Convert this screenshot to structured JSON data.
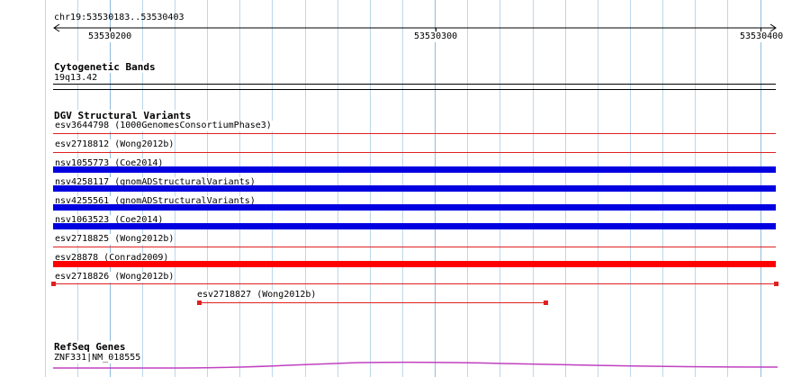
{
  "ruler": {
    "coordinates": "chr19:53530183..53530403",
    "tick_labels": [
      "53530200",
      "53530300",
      "53530400"
    ]
  },
  "tracks": {
    "cytoband": {
      "title": "Cytogenetic Bands",
      "band_label": "19q13.42"
    },
    "dgv": {
      "title": "DGV Structural Variants",
      "features": [
        {
          "label": "esv3644798 (1000GenomesConsortiumPhase3)",
          "color": "#e02020",
          "style": "thin"
        },
        {
          "label": "esv2718812 (Wong2012b)",
          "color": "#e02020",
          "style": "thin"
        },
        {
          "label": "nsv1055773 (Coe2014)",
          "color": "#0000e0",
          "style": "thick"
        },
        {
          "label": "nsv4258117 (gnomADStructuralVariants)",
          "color": "#0000e0",
          "style": "thick"
        },
        {
          "label": "nsv4255561 (gnomADStructuralVariants)",
          "color": "#0000e0",
          "style": "thick"
        },
        {
          "label": "nsv1063523 (Coe2014)",
          "color": "#0000e0",
          "style": "thick"
        },
        {
          "label": "esv2718825 (Wong2012b)",
          "color": "#e02020",
          "style": "thin"
        },
        {
          "label": "esv28878 (Conrad2009)",
          "color": "#ff0000",
          "style": "thick"
        },
        {
          "label": "esv2718826 (Wong2012b)",
          "color": "#e02020",
          "style": "capped"
        },
        {
          "label": "esv2718827 (Wong2012b)",
          "color": "#e02020",
          "style": "capped-partial"
        }
      ]
    },
    "refseq": {
      "title": "RefSeq Genes",
      "gene_label": "ZNF331|NM_018555",
      "color": "#c040c0"
    }
  }
}
